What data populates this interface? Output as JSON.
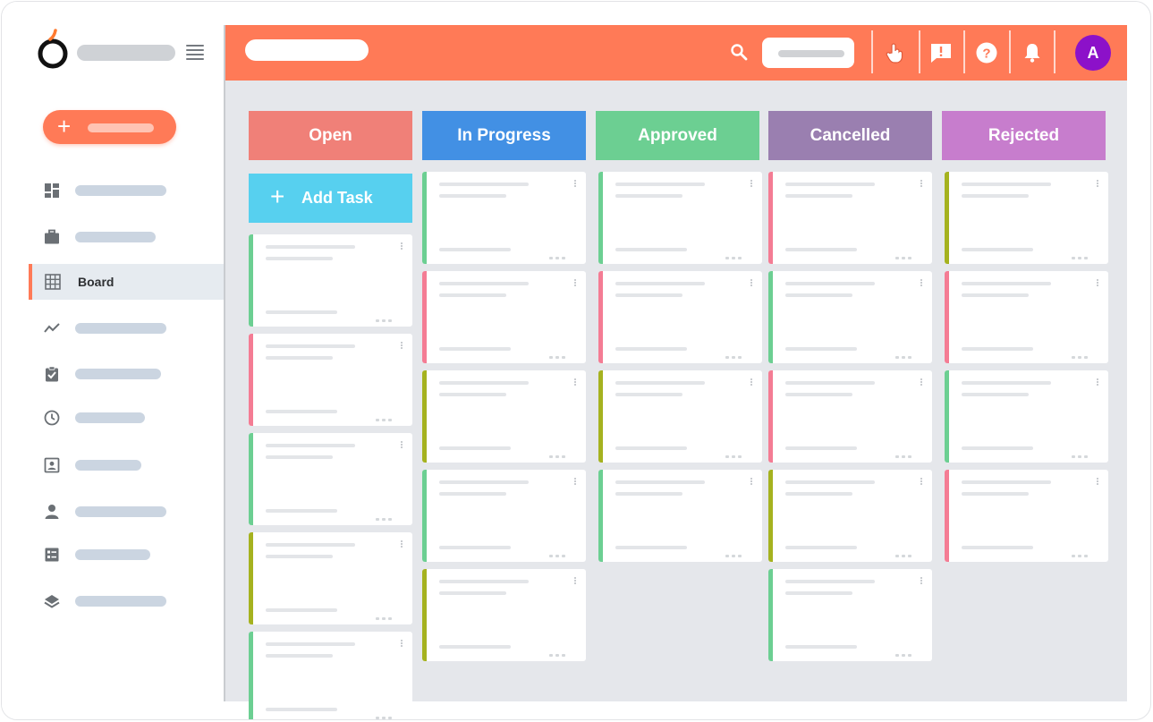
{
  "sidebar": {
    "active_item_label": "Board",
    "items": [
      {
        "name": "dashboard-icon"
      },
      {
        "name": "briefcase-icon"
      },
      {
        "name": "grid-icon",
        "label": "Board"
      },
      {
        "name": "trend-chart-icon"
      },
      {
        "name": "clipboard-check-icon"
      },
      {
        "name": "clock-icon"
      },
      {
        "name": "contact-card-icon"
      },
      {
        "name": "person-icon"
      },
      {
        "name": "list-icon"
      },
      {
        "name": "layers-icon"
      }
    ]
  },
  "header": {
    "avatar_initial": "A",
    "icons": [
      "search-icon",
      "hand-pointer-icon",
      "feedback-icon",
      "help-icon",
      "bell-icon"
    ]
  },
  "board": {
    "add_task_label": "Add Task",
    "columns": [
      {
        "title": "Open",
        "color": "#f08078",
        "cards": [
          "#6ccf92",
          "#f47c94",
          "#6ccf92",
          "#a5b21f",
          "#6ccf92"
        ]
      },
      {
        "title": "In Progress",
        "color": "#4290e4",
        "cards": [
          "#6ccf92",
          "#f47c94",
          "#a5b21f",
          "#6ccf92",
          "#a5b21f"
        ]
      },
      {
        "title": "Approved",
        "color": "#6ccf92",
        "cards": [
          "#6ccf92",
          "#f47c94",
          "#a5b21f",
          "#6ccf92"
        ]
      },
      {
        "title": "Cancelled",
        "color": "#9a7fb0",
        "cards": [
          "#f47c94",
          "#6ccf92",
          "#f47c94",
          "#a5b21f",
          "#6ccf92"
        ]
      },
      {
        "title": "Rejected",
        "color": "#c77dcd",
        "cards": [
          "#a5b21f",
          "#f47c94",
          "#6ccf92",
          "#f47c94"
        ]
      }
    ]
  },
  "colors": {
    "accent": "#ff7a57",
    "avatar": "#8c11c9",
    "add_task": "#57d0ef",
    "board_background": "#e5e7eb"
  }
}
